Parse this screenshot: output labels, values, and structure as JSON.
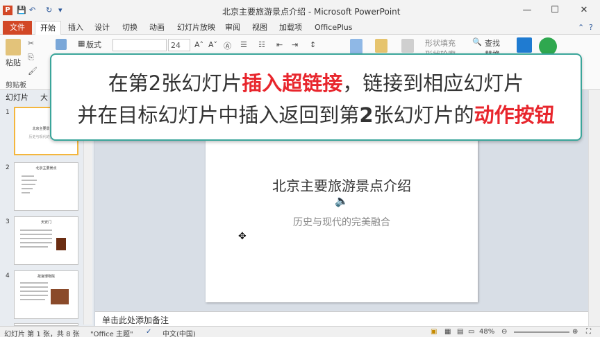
{
  "window": {
    "title": "北京主要旅游景点介绍 - Microsoft PowerPoint",
    "app_icon": "P",
    "minimize": "—",
    "maximize": "☐",
    "close": "✕"
  },
  "ribbon_tabs": {
    "file": "文件",
    "items": [
      "开始",
      "插入",
      "设计",
      "切换",
      "动画",
      "幻灯片放映",
      "审阅",
      "视图",
      "加载项",
      "OfficePlus"
    ]
  },
  "ribbon": {
    "paste": "粘贴",
    "clipboard_group": "剪贴板",
    "layout": "版式",
    "font_size": "24",
    "find": "查找",
    "shape_fill": "形状填充",
    "shape_outline": "形状轮廓",
    "replace": "替换"
  },
  "left_pane": {
    "tab_slides": "幻灯片",
    "tab_outline": "大",
    "slides": [
      {
        "num": "1",
        "title": "北京主要景点介绍",
        "subtitle": "历史与现代的完美融合"
      },
      {
        "num": "2",
        "title": "北京主要景点"
      },
      {
        "num": "3",
        "title": "天安门"
      },
      {
        "num": "4",
        "title": "故宫博物院"
      }
    ]
  },
  "slide": {
    "title": "北京主要旅游景点介绍",
    "subtitle": "历史与现代的完美融合"
  },
  "notes": {
    "placeholder": "单击此处添加备注"
  },
  "statusbar": {
    "slide_info": "幻灯片 第 1 张，共 8 张",
    "theme": "\"Office 主题\"",
    "language": "中文(中国)",
    "zoom": "48%"
  },
  "callout": {
    "line1_a": "在第2张幻灯片",
    "line1_hl": "插入超链接",
    "line1_b": "，链接到相应幻灯片",
    "line2_a": "并在目标幻灯片中插入返回到第",
    "line2_num": "2",
    "line2_b": "张幻灯片的",
    "line2_hl": "动作按钮"
  },
  "colors": {
    "accent": "#d24726",
    "highlight": "#e8262d",
    "callout_border": "#3aa59a",
    "selection": "#f4b63d"
  }
}
